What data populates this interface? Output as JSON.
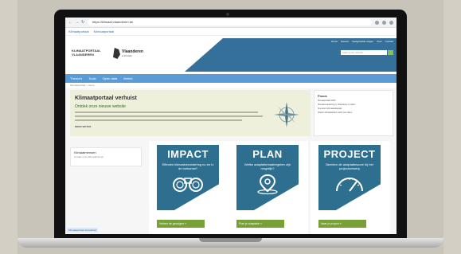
{
  "browser": {
    "url": "https://klimaat.vlaanderen.be",
    "tabs": [
      "Klimaatportaal",
      "Klimaatportaal"
    ]
  },
  "header": {
    "logo_klimaat": "KLIMAATPORTAAL VLAANDEREN",
    "logo_vlaanderen": "Vlaanderen",
    "logo_vlaanderen_sub": "is klimaat",
    "toplinks": [
      "Home",
      "Nieuws",
      "Veelgestelde vragen",
      "Over",
      "Contact"
    ],
    "search_placeholder": "Zoek op de website"
  },
  "menu": [
    "Thema's",
    "Tools",
    "Open data",
    "Beleid"
  ],
  "breadcrumb": "Klimaatportaal > Home",
  "hero": {
    "title": "Klimaatportaal verhuist",
    "subtitle": "Ontdek onze nieuwe website",
    "more": "MEER WETEN"
  },
  "focus": {
    "title": "Focus",
    "items": [
      "Klimaatportaal 2050",
      "Klimaatverandering in Vlaanderen in cijfers",
      "Scenario's klimaatadaptatie",
      "Vlaams klimaatbeleid: stand van zaken"
    ]
  },
  "side": {
    "title": "Klimaatmensen",
    "subtitle": "Ontdek onze klimaatbrieven"
  },
  "bottom_tag": "Klimaatportaal nieuwsbrief",
  "cards": [
    {
      "title": "IMPACT",
      "subtitle": "Effecten klimaatverandering nu en in de toekomst?",
      "button": "Verken de gevolgen »",
      "icon": "binoculars-icon"
    },
    {
      "title": "PLAN",
      "subtitle": "Welke adaptatiemaatregelen zijn mogelijk?",
      "button": "Plan je adaptatie »",
      "icon": "map-pin-icon"
    },
    {
      "title": "PROJECT",
      "subtitle": "Bereken de adaptatiescore bij het projectontwerp",
      "button": "Naar je project »",
      "icon": "gauge-icon"
    }
  ],
  "colors": {
    "tile_blue": "#2e6f8f",
    "button_green": "#77a136",
    "menu_blue": "#5b9bd5"
  }
}
